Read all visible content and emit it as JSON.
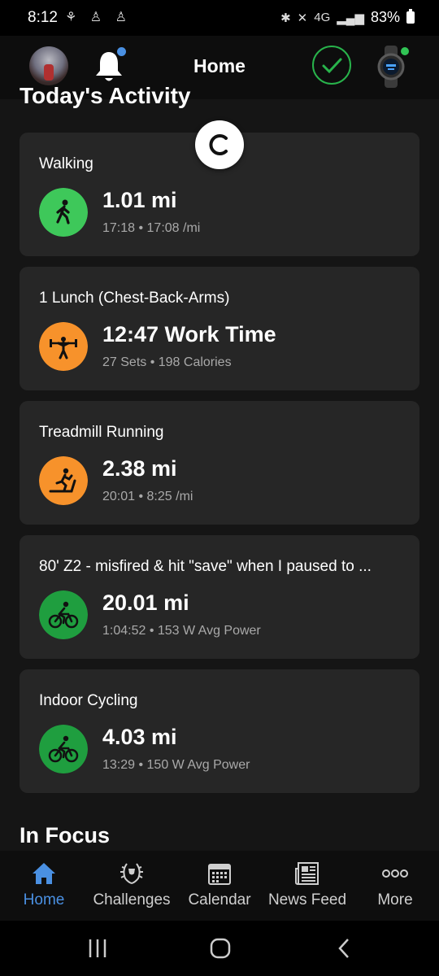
{
  "status_bar": {
    "time": "8:12",
    "left_icons": "⚘ ♙ ♙",
    "network": "4G",
    "battery": "83%"
  },
  "header": {
    "title": "Home"
  },
  "section": {
    "title": "Today's Activity"
  },
  "activities": [
    {
      "title": "Walking",
      "main": "1.01 mi",
      "sub": "17:18 • 17:08 /mi",
      "color": "#3ec85a",
      "icon": "walking-icon"
    },
    {
      "title": "1 Lunch (Chest-Back-Arms)",
      "main": "12:47 Work Time",
      "sub": "27 Sets • 198 Calories",
      "color": "#f7922b",
      "icon": "strength-icon"
    },
    {
      "title": "Treadmill Running",
      "main": "2.38 mi",
      "sub": "20:01 • 8:25 /mi",
      "color": "#f7922b",
      "icon": "treadmill-icon"
    },
    {
      "title": "80' Z2 - misfired & hit \"save\" when I paused to ...",
      "main": "20.01 mi",
      "sub": "1:04:52 • 153 W Avg Power",
      "color": "#1f9e3f",
      "icon": "cycling-icon"
    },
    {
      "title": "Indoor Cycling",
      "main": "4.03 mi",
      "sub": "13:29 • 150 W Avg Power",
      "color": "#1f9e3f",
      "icon": "cycling-icon"
    }
  ],
  "in_focus": {
    "title": "In Focus"
  },
  "nav": [
    {
      "label": "Home",
      "icon": "home-icon",
      "active": true
    },
    {
      "label": "Challenges",
      "icon": "laurel-icon"
    },
    {
      "label": "Calendar",
      "icon": "calendar-icon"
    },
    {
      "label": "News Feed",
      "icon": "newspaper-icon"
    },
    {
      "label": "More",
      "icon": "more-icon"
    }
  ],
  "colors": {
    "accent": "#4a90e2",
    "success": "#28b34b"
  }
}
